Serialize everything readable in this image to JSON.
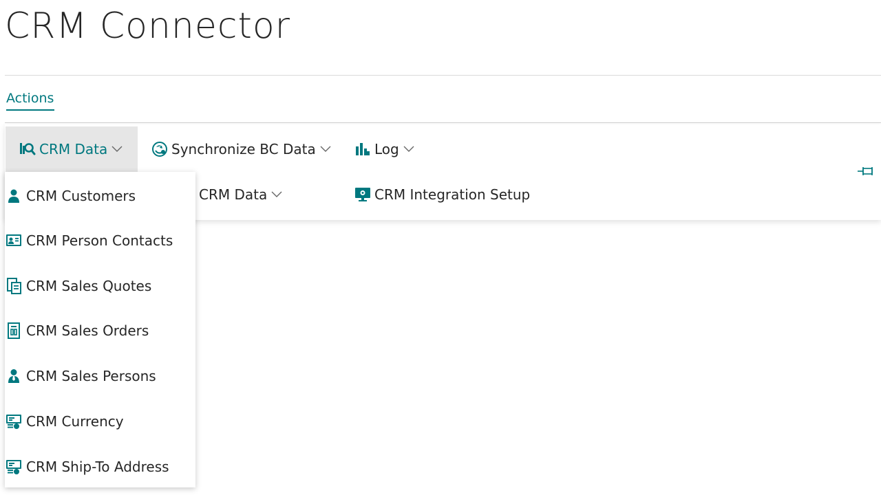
{
  "page": {
    "title": "CRM Connector"
  },
  "tabs": {
    "actions": "Actions"
  },
  "colors": {
    "accent": "#00787f",
    "selected_bg": "#e6e6e6"
  },
  "actions": {
    "crm_data": {
      "label": "CRM Data",
      "icon": "search-data-icon"
    },
    "synchronize": {
      "label": "Synchronize BC Data",
      "icon": "sync-globe-icon"
    },
    "log": {
      "label": "Log",
      "icon": "log-chart-icon"
    },
    "setup_crm_data": {
      "visible_label": "p CRM Data"
    },
    "integration_setup": {
      "label": "CRM Integration Setup",
      "icon": "monitor-setup-icon"
    },
    "pin": {
      "icon": "pin-icon"
    }
  },
  "menu": {
    "items": [
      {
        "label": "CRM Customers",
        "icon": "person-icon"
      },
      {
        "label": "CRM Person Contacts",
        "icon": "contact-card-icon"
      },
      {
        "label": "CRM Sales Quotes",
        "icon": "quote-document-icon"
      },
      {
        "label": "CRM Sales Orders",
        "icon": "order-document-icon"
      },
      {
        "label": "CRM Sales Persons",
        "icon": "salesperson-icon"
      },
      {
        "label": "CRM Currency",
        "icon": "currency-icon"
      },
      {
        "label": "CRM Ship-To Address",
        "icon": "ship-to-address-icon"
      }
    ]
  }
}
